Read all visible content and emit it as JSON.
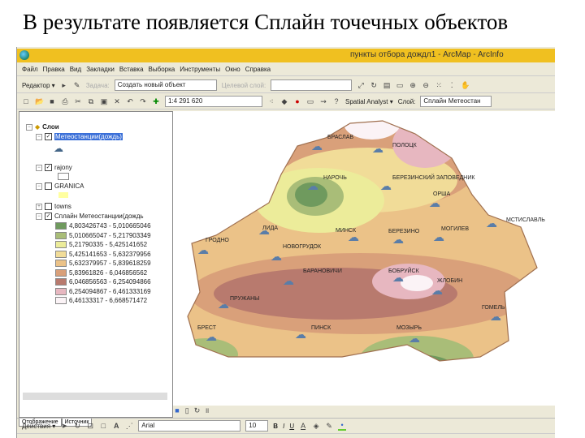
{
  "slide_title": "В результате появляется Сплайн точечных объектов",
  "window": {
    "title": "пункты отбора дождл1 - ArcMap - ArcInfo"
  },
  "menu": [
    "Файл",
    "Правка",
    "Вид",
    "Закладки",
    "Вставка",
    "Выборка",
    "Инструменты",
    "Окно",
    "Справка"
  ],
  "editor_toolbar": {
    "editor": "Редактор ▾",
    "task_label": "Задача:",
    "task_value": "Создать новый объект",
    "target_label": "Целевой слой:"
  },
  "standard_toolbar": {
    "scale": "1:4 291 620",
    "spatial_analyst": "Spatial Analyst ▾",
    "layer_label": "Слой:",
    "layer_value": "Сплайн  Метеостан"
  },
  "toc": {
    "root": "Слои",
    "layers": [
      {
        "name": "Метеостанции(дождь)",
        "checked": true
      },
      {
        "name": "rajony",
        "checked": true
      },
      {
        "name": "GRANICA",
        "checked": false
      },
      {
        "name": "towns",
        "checked": false
      },
      {
        "name": "Сплайн  Метеостанции(дождь",
        "checked": true
      }
    ],
    "legend": [
      {
        "label": "4,803426743 - 5,010665046",
        "color": "#6f9a5e"
      },
      {
        "label": "5,010665047 - 5,217903349",
        "color": "#a9bd78"
      },
      {
        "label": "5,21790335 - 5,425141652",
        "color": "#ecec9a"
      },
      {
        "label": "5,425141653 - 5,632379956",
        "color": "#f1dc98"
      },
      {
        "label": "5,632379957 - 5,839618259",
        "color": "#ebc288"
      },
      {
        "label": "5,83961826 - 6,046856562",
        "color": "#d9a07a"
      },
      {
        "label": "6,046856563 - 6,254094866",
        "color": "#b87a6e"
      },
      {
        "label": "6,254094867 - 6,461333169",
        "color": "#e7b7c0"
      },
      {
        "label": "6,46133317 - 6,668571472",
        "color": "#fbf3f6"
      }
    ],
    "tabs": [
      "Отображение",
      "Источник"
    ]
  },
  "map": {
    "cities": [
      "БРАСЛАВ",
      "ПОЛОЦК",
      "НАРОЧЬ",
      "БЕРЕЗИНСКИЙ ЗАПОВЕДНИК",
      "ОРША",
      "МСТИСЛАВЛЬ",
      "ЛИДА",
      "МИНСК",
      "БЕРЕЗИНО",
      "МОГИЛЕВ",
      "ГРОДНО",
      "НОВОГРУДОК",
      "БАРАНОВИЧИ",
      "БОБРУЙСК",
      "ЖЛОБИН",
      "ПРУЖАНЫ",
      "ГОМЕЛЬ",
      "БРЕСТ",
      "ПИНСК",
      "МОЗЫРЬ"
    ]
  },
  "draw_toolbar": {
    "actions": "Действия ▾",
    "font": "Arial",
    "size": "10",
    "bold": "B",
    "italic": "I",
    "underline": "U"
  }
}
